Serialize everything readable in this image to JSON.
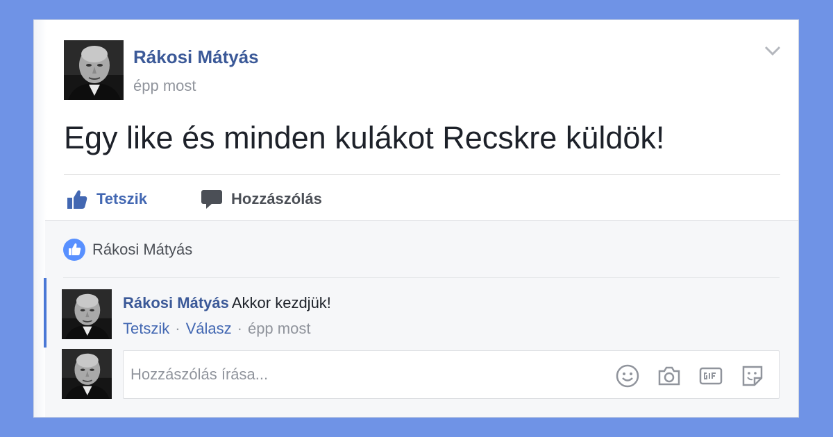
{
  "post": {
    "author": "Rákosi Mátyás",
    "time": "épp most",
    "text": "Egy like és minden kulákot Recskre küldök!"
  },
  "actions": {
    "like_label": "Tetszik",
    "comment_label": "Hozzászólás"
  },
  "likes": {
    "names": "Rákosi Mátyás"
  },
  "comment": {
    "author": "Rákosi Mátyás",
    "text": "Akkor kezdjük!",
    "like_label": "Tetszik",
    "reply_label": "Válasz",
    "separator": "·",
    "time": "épp most"
  },
  "comment_input": {
    "placeholder": "Hozzászólás írása..."
  },
  "icons": {
    "options": "chevron-down-icon",
    "like": "thumbs-up-icon",
    "comment": "speech-bubble-icon",
    "emoji": "smiley-icon",
    "photo": "camera-icon",
    "gif": "gif-icon",
    "sticker": "sticker-icon"
  },
  "colors": {
    "background": "#6f93e6",
    "link_blue": "#3b5998",
    "action_blue": "#4267b2"
  }
}
